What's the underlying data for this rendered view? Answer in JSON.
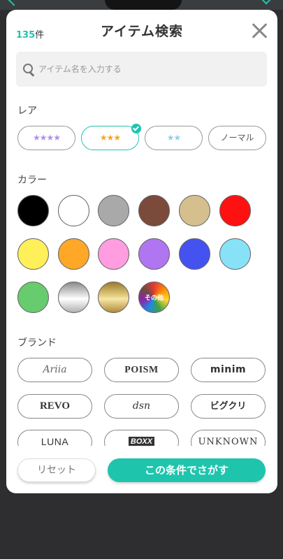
{
  "header": {
    "count_num": "135",
    "count_unit": "件",
    "title": "アイテム検索"
  },
  "search": {
    "placeholder": "アイテム名を入力する"
  },
  "rarity": {
    "label": "レア",
    "options": [
      {
        "stars": "★★★★",
        "star_color": "#b58ee8",
        "selected": false
      },
      {
        "stars": "★★★",
        "star_color": "#f5a623",
        "selected": true
      },
      {
        "stars": "★★",
        "star_color": "#8fd0e6",
        "selected": false
      },
      {
        "label": "ノーマル",
        "selected": false
      }
    ]
  },
  "color": {
    "label": "カラー",
    "swatches": [
      {
        "name": "black",
        "hex": "#000000"
      },
      {
        "name": "white",
        "hex": "#ffffff"
      },
      {
        "name": "gray",
        "hex": "#a9a9a9"
      },
      {
        "name": "brown",
        "hex": "#7b4a3b"
      },
      {
        "name": "beige",
        "hex": "#d6bf8f"
      },
      {
        "name": "red",
        "hex": "#ff1111"
      },
      {
        "name": "yellow",
        "hex": "#fff05a"
      },
      {
        "name": "orange",
        "hex": "#ffa726"
      },
      {
        "name": "pink",
        "hex": "#ff9de0"
      },
      {
        "name": "purple",
        "hex": "#b075f0"
      },
      {
        "name": "blue",
        "hex": "#4452f0"
      },
      {
        "name": "light-blue",
        "hex": "#88e2f7"
      },
      {
        "name": "green",
        "hex": "#66cc6e"
      },
      {
        "name": "silver",
        "hex": "#c8c8c8"
      },
      {
        "name": "gold",
        "hex": "#c9a74f"
      },
      {
        "name": "other",
        "label": "その他"
      }
    ]
  },
  "brand": {
    "label": "ブランド",
    "items": [
      "Ariia",
      "POISM",
      "minim",
      "REVO",
      "dsn",
      "ビグクリ",
      "LUNA",
      "BOXX",
      "UNKNOWN"
    ]
  },
  "footer": {
    "reset_label": "リセット",
    "search_label": "この条件でさがす"
  }
}
